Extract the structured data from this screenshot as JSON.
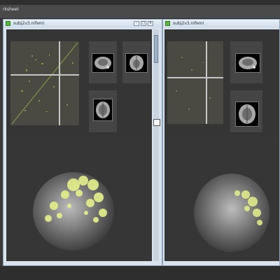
{
  "app": {
    "title": "rksheet"
  },
  "windows": [
    {
      "title": "subj2v3.nifemi",
      "buttons": [
        "-",
        "□",
        "×"
      ]
    },
    {
      "title": "subj2v3.nifemi"
    }
  ],
  "colors": {
    "activation": "#e6f08a",
    "background": "#3b3b3b",
    "titlebar": "#d9e4ef"
  }
}
